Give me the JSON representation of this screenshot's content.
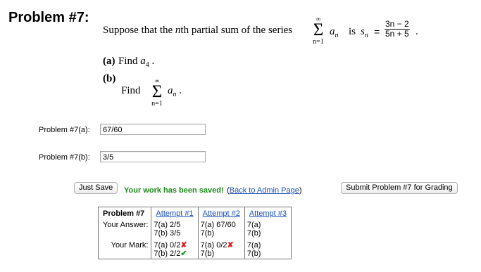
{
  "problem": {
    "title": "Problem #7:",
    "statement_before": "Suppose that the ",
    "statement_n": "n",
    "statement_middle": "th partial sum of the series",
    "sigma_top": "∞",
    "sigma_bottom": "n=1",
    "sum_term": "a",
    "sum_sub": "n",
    "is_word": "is",
    "sn": "s",
    "sn_sub": "n",
    "equals": "=",
    "frac_num": "3n − 2",
    "frac_den": "5n + 5",
    "period": ".",
    "part_a_label": "(a)",
    "part_a_text": "Find ",
    "part_a_var": "a",
    "part_a_sub": "4",
    "part_b_label": "(b)",
    "part_b_text": "Find",
    "part_b_sigma_top": "∞",
    "part_b_sigma_bottom": "n=1",
    "part_b_term": "a",
    "part_b_sub": "n"
  },
  "answers": {
    "a_label": "Problem #7(a):",
    "a_value": "67/60",
    "b_label": "Problem #7(b):",
    "b_value": "3/5"
  },
  "actions": {
    "just_save": "Just Save",
    "saved_msg": "Your work has been saved!",
    "paren_open": "(",
    "back_link": "Back to Admin Page",
    "paren_close": ")",
    "submit": "Submit Problem #7 for Grading"
  },
  "attempts": {
    "header": "Problem #7",
    "columns": [
      "Attempt #1",
      "Attempt #2",
      "Attempt #3"
    ],
    "your_answer_label": "Your Answer:",
    "your_mark_label": "Your Mark:",
    "answers": [
      [
        "7(a) 2/5",
        "7(b) 3/5"
      ],
      [
        "7(a) 67/60",
        "7(b)"
      ],
      [
        "7(a)",
        "7(b)"
      ]
    ],
    "marks": [
      [
        {
          "text": "7(a) 0/2",
          "mark": "✘"
        },
        {
          "text": "7(b) 2/2",
          "mark": "✔"
        }
      ],
      [
        {
          "text": "7(a) 0/2",
          "mark": "✘"
        },
        {
          "text": "7(b)",
          "mark": ""
        }
      ],
      [
        {
          "text": "7(a)",
          "mark": ""
        },
        {
          "text": "7(b)",
          "mark": ""
        }
      ]
    ]
  },
  "colors": {
    "saved_green": "#1a8a1a",
    "link_blue": "#1a4fb5",
    "wrong_red": "#e02020",
    "right_green": "#1a9a1a"
  }
}
